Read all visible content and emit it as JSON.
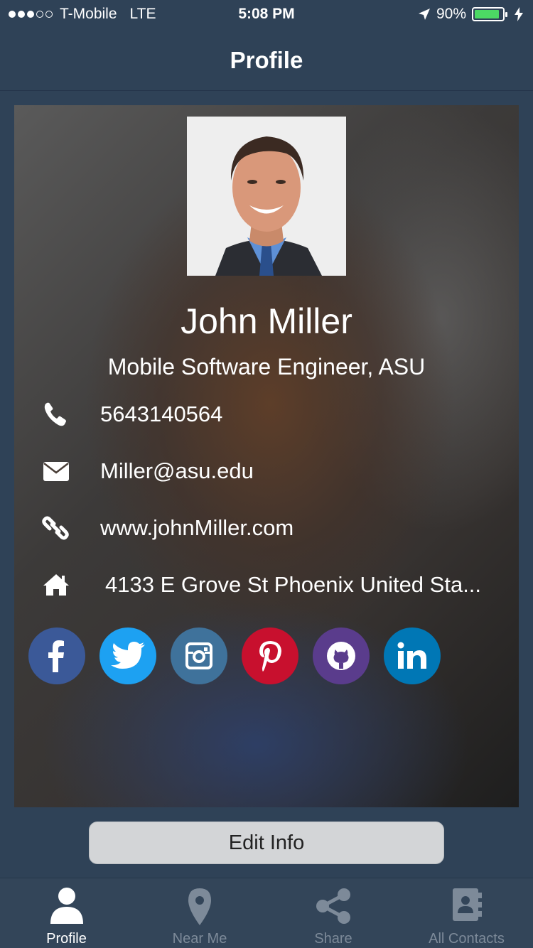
{
  "status_bar": {
    "carrier": "T-Mobile",
    "network": "LTE",
    "time": "5:08 PM",
    "battery_percent": "90%",
    "battery_level": 0.9,
    "signal_bars": 3,
    "signal_total": 5
  },
  "nav": {
    "title": "Profile"
  },
  "profile": {
    "name": "John Miller",
    "job": "Mobile Software Engineer, ASU",
    "phone": "5643140564",
    "email": "Miller@asu.edu",
    "website": "www.johnMiller.com",
    "address": "4133 E Grove St Phoenix United Sta..."
  },
  "socials": [
    {
      "name": "facebook",
      "color": "#3b5998"
    },
    {
      "name": "twitter",
      "color": "#1da1f2"
    },
    {
      "name": "instagram",
      "color": "#3f729b"
    },
    {
      "name": "pinterest",
      "color": "#c8102e"
    },
    {
      "name": "github",
      "color": "#5a3c8c"
    },
    {
      "name": "linkedin",
      "color": "#0077b5"
    }
  ],
  "edit_button": {
    "label": "Edit Info"
  },
  "tabs": [
    {
      "label": "Profile",
      "icon": "person-icon",
      "active": true
    },
    {
      "label": "Near Me",
      "icon": "location-pin-icon",
      "active": false
    },
    {
      "label": "Share",
      "icon": "share-icon",
      "active": false
    },
    {
      "label": "All Contacts",
      "icon": "contacts-book-icon",
      "active": false
    }
  ],
  "colors": {
    "background": "#2f4257",
    "tab_inactive": "#7d8a99",
    "tab_active": "#ffffff",
    "button_bg": "#d3d5d7",
    "battery_fill": "#4cd964"
  }
}
